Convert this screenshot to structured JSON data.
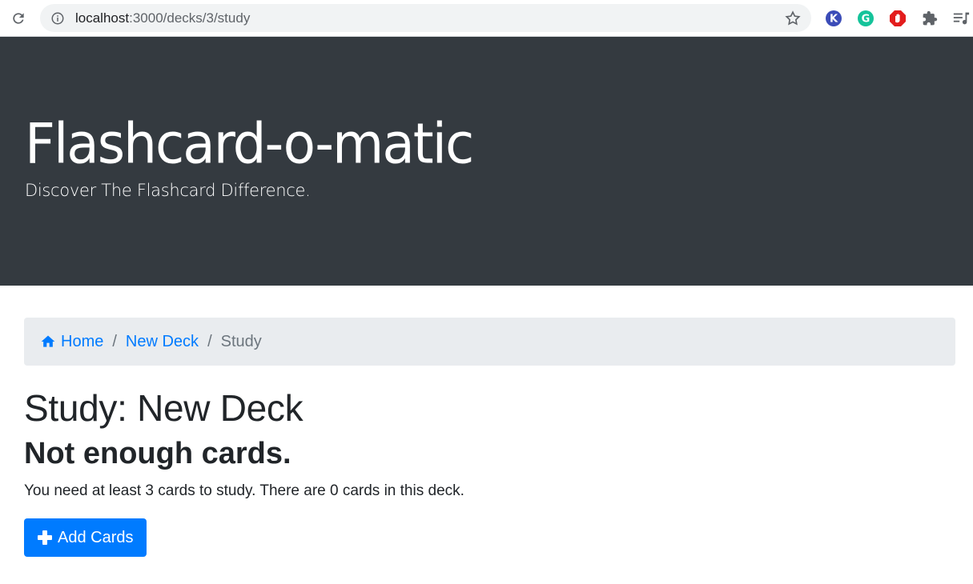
{
  "browser": {
    "url_host": "localhost",
    "url_path": ":3000/decks/3/study",
    "extensions": [
      "k-extension-icon",
      "grammarly-icon",
      "adblock-icon",
      "puzzle-icon",
      "media-playlist-icon"
    ]
  },
  "header": {
    "title": "Flashcard-o-matic",
    "tagline": "Discover The Flashcard Difference."
  },
  "breadcrumb": {
    "home": "Home",
    "deck": "New Deck",
    "current": "Study",
    "separator": "/"
  },
  "main": {
    "title": "Study: New Deck",
    "subtitle": "Not enough cards.",
    "message": "You need at least 3 cards to study. There are 0 cards in this deck.",
    "add_cards_label": "Add Cards"
  },
  "colors": {
    "jumbotron": "#343a40",
    "primary": "#007bff",
    "breadcrumb_bg": "#e9ecef"
  }
}
